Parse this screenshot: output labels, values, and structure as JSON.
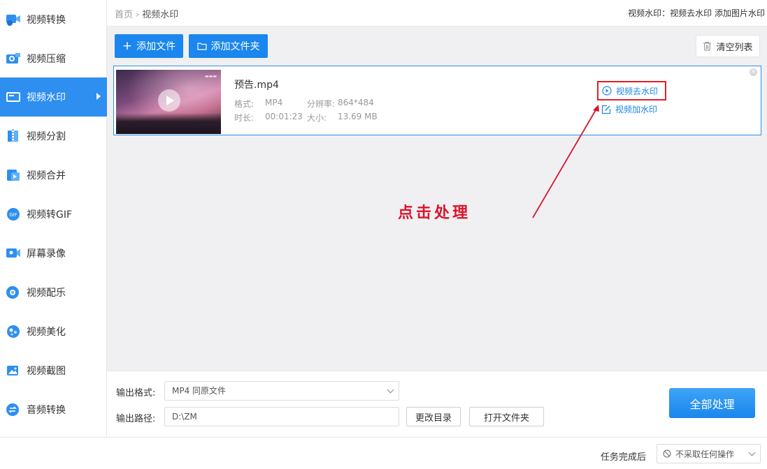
{
  "sidebar": {
    "items": [
      {
        "label": "视频转换",
        "icon": "video-convert-icon",
        "active": false
      },
      {
        "label": "视频压缩",
        "icon": "video-compress-icon",
        "active": false
      },
      {
        "label": "视频水印",
        "icon": "video-watermark-icon",
        "active": true
      },
      {
        "label": "视频分割",
        "icon": "video-split-icon",
        "active": false
      },
      {
        "label": "视频合并",
        "icon": "video-merge-icon",
        "active": false
      },
      {
        "label": "视频转GIF",
        "icon": "gif-icon",
        "active": false
      },
      {
        "label": "屏幕录像",
        "icon": "screen-record-icon",
        "active": false
      },
      {
        "label": "视频配乐",
        "icon": "music-icon",
        "active": false
      },
      {
        "label": "视频美化",
        "icon": "beautify-icon",
        "active": false
      },
      {
        "label": "视频截图",
        "icon": "screenshot-icon",
        "active": false
      },
      {
        "label": "音频转换",
        "icon": "audio-convert-icon",
        "active": false
      }
    ]
  },
  "header": {
    "breadcrumb_home": "首页",
    "breadcrumb_current": "视频水印",
    "right_text": "视频水印：视频去水印 添加图片水印"
  },
  "toolbar": {
    "add_file": "添加文件",
    "add_folder": "添加文件夹",
    "clear_list": "清空列表"
  },
  "file": {
    "name": "预告.mp4",
    "format_label": "格式:",
    "format_value": "MP4",
    "resolution_label": "分辨率:",
    "resolution_value": "864*484",
    "duration_label": "时长:",
    "duration_value": "00:01:23",
    "size_label": "大小:",
    "size_value": "13.69 MB",
    "action_remove": "视频去水印",
    "action_add": "视频加水印"
  },
  "annotation": {
    "text": "点击处理",
    "color": "#d9142c"
  },
  "output": {
    "format_label": "输出格式:",
    "format_value": "MP4  同原文件",
    "path_label": "输出路径:",
    "path_value": "D:\\ZM",
    "change_dir": "更改目录",
    "open_folder": "打开文件夹",
    "process_all": "全部处理"
  },
  "status": {
    "after_done_label": "任务完成后",
    "after_done_value": "不采取任何操作"
  },
  "colors": {
    "accent": "#1a86ee",
    "active_sidebar": "#2e8ff0",
    "highlight_box": "#e41e26"
  }
}
